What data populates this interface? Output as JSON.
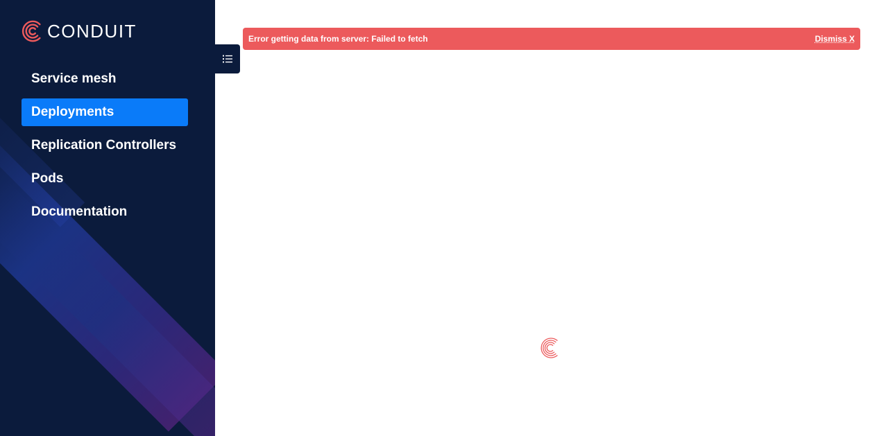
{
  "brand": {
    "name": "CONDUIT",
    "accent_color": "#ec5a5c"
  },
  "sidebar": {
    "items": [
      {
        "label": "Service mesh",
        "active": false
      },
      {
        "label": "Deployments",
        "active": true
      },
      {
        "label": "Replication Controllers",
        "active": false
      },
      {
        "label": "Pods",
        "active": false
      },
      {
        "label": "Documentation",
        "active": false
      }
    ],
    "toggle_icon": "list-icon",
    "background_color": "#0b1b3c",
    "active_color": "#0a7bf9"
  },
  "error_banner": {
    "message": "Error getting data from server: Failed to fetch",
    "dismiss_label": "Dismiss X",
    "color": "#ec5a5c"
  },
  "main": {
    "loading_icon": "conduit-spinner-icon"
  }
}
